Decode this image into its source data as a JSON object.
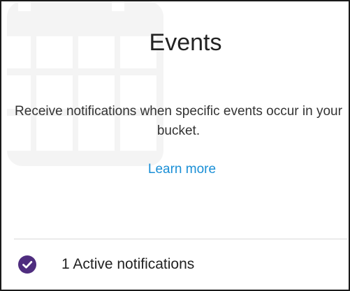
{
  "card": {
    "title": "Events",
    "description": "Receive notifications when specific events occur in your bucket.",
    "learn_more": "Learn more",
    "background_icon": "calendar-icon"
  },
  "status": {
    "icon": "check-circle-icon",
    "text": "1 Active notifications"
  },
  "colors": {
    "link": "#1a8fd6",
    "check_badge": "#4f2d7f",
    "background_icon": "#f4f4f4",
    "divider": "#d9d9d9",
    "border": "#1a1a1a"
  }
}
